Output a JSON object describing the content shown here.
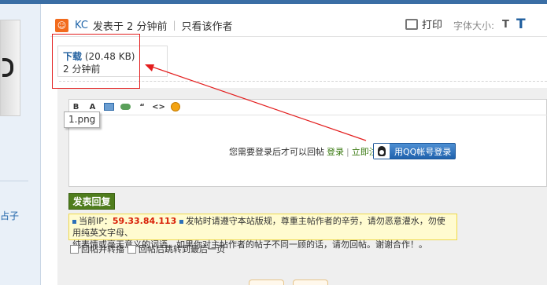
{
  "post_header": {
    "author": "KC",
    "posted": "发表于 2 分钟前",
    "only_author": "只看该作者",
    "print": "打印",
    "font_size_label": "字体大小:",
    "font_small": "T",
    "font_large": "T"
  },
  "attachment": {
    "link_text": "下载",
    "size": "(20.48 KB)",
    "time": "2 分钟前"
  },
  "left_sidebar": {
    "fragment_text": "占子"
  },
  "editor": {
    "toolbar": {
      "bold": "B",
      "font": "A",
      "quote": "“",
      "code": "<>"
    },
    "tooltip": "1.png",
    "login_prompt": "您需要登录后才可以回帖",
    "login": "登录",
    "register": "立即注册",
    "qq_login": "用QQ帐号登录"
  },
  "submit_button": "发表回复",
  "notice": {
    "ip_label": "当前IP：",
    "ip": "59.33.84.113",
    "text1": "发帖时请遵守本站版规，尊重主帖作者的辛劳，请勿恶意灌水，勿使用纯英文字母、",
    "text2": "纯表情或毫无意义的词语。如果你对主帖作者的帖子不同一顾的话，请勿回帖。谢谢合作！。"
  },
  "options": {
    "repost": "回帖并转播",
    "jump_last": "回帖后跳转到最后一页"
  },
  "colors": {
    "annotation_red": "#e31d1d",
    "link_blue": "#1f5e9e",
    "submit_green": "#4f7d1d"
  }
}
